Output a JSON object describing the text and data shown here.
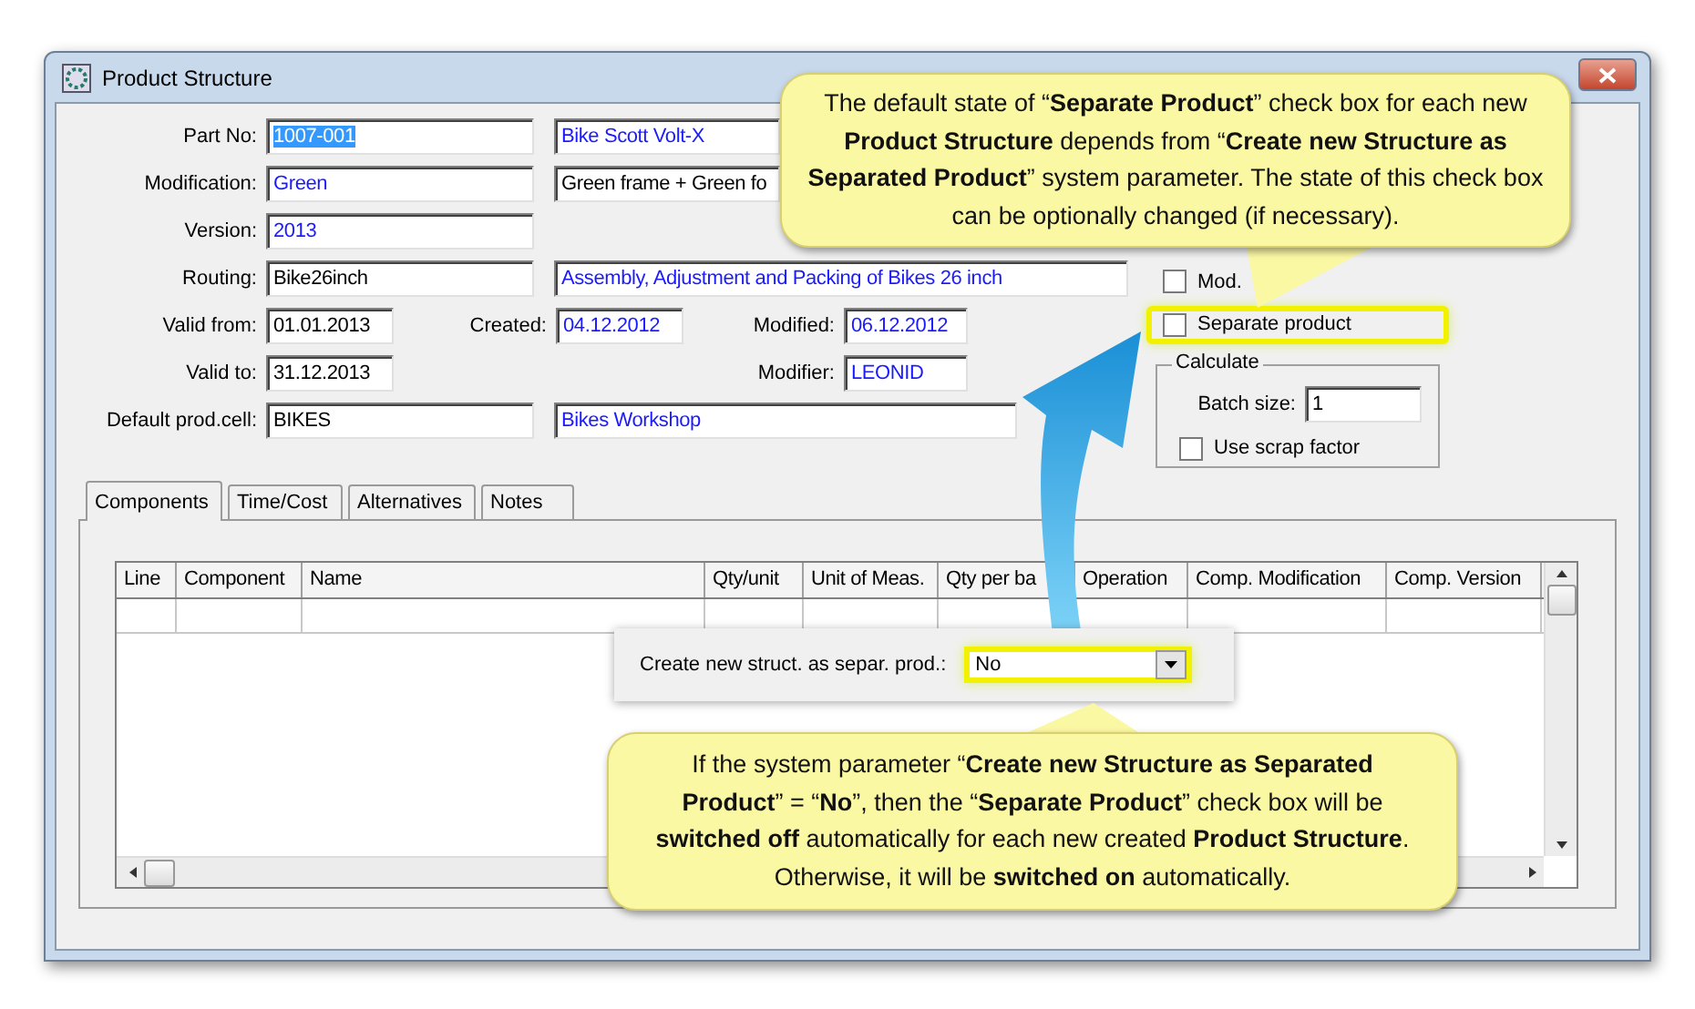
{
  "window": {
    "title": "Product Structure"
  },
  "form": {
    "part_no": {
      "label": "Part No:",
      "code": {
        "value": "1007-001",
        "text_selected": true
      },
      "name": {
        "value": "Bike Scott Volt-X",
        "readonly": true
      }
    },
    "modification": {
      "label": "Modification:",
      "code": {
        "value": "Green",
        "readonly": true
      },
      "name": {
        "value": "Green frame + Green fo",
        "readonly": false
      }
    },
    "version": {
      "label": "Version:",
      "code": {
        "value": "2013",
        "readonly": true
      }
    },
    "routing": {
      "label": "Routing:",
      "code": {
        "value": "Bike26inch",
        "readonly": false
      },
      "name": {
        "value": "Assembly, Adjustment and Packing of Bikes 26 inch",
        "readonly": true
      }
    },
    "valid_from": {
      "label": "Valid from:",
      "value": "01.01.2013",
      "readonly": false
    },
    "created": {
      "label": "Created:",
      "value": "04.12.2012",
      "readonly": true
    },
    "modified": {
      "label": "Modified:",
      "value": "06.12.2012",
      "readonly": true
    },
    "valid_to": {
      "label": "Valid to:",
      "value": "31.12.2013",
      "readonly": false
    },
    "modifier": {
      "label": "Modifier:",
      "value": "LEONID",
      "readonly": true
    },
    "default_prod_cell": {
      "label": "Default prod.cell:",
      "code": {
        "value": "BIKES",
        "readonly": false
      },
      "name": {
        "value": "Bikes Workshop",
        "readonly": true
      }
    }
  },
  "options": {
    "mod_p": {
      "label": "Mod.",
      "checked": false
    },
    "separate_product": {
      "label": "Separate product",
      "checked": false,
      "highlighted": true
    },
    "calculate": {
      "title": "Calculate",
      "batch_size": {
        "label": "Batch size:",
        "value": "1"
      },
      "use_scrap_factor": {
        "label": "Use scrap factor",
        "checked": false
      }
    }
  },
  "tabs": [
    {
      "label": "Components",
      "selected": true
    },
    {
      "label": "Time/Cost",
      "selected": false
    },
    {
      "label": "Alternatives",
      "selected": false
    },
    {
      "label": "Notes",
      "selected": false
    }
  ],
  "table": {
    "columns": [
      "Line",
      "Component",
      "Name",
      "Qty/unit",
      "Unit of Meas.",
      "Qty per ba",
      "Operation",
      "Comp. Modification",
      "Comp. Version"
    ]
  },
  "parameter_popup": {
    "label": "Create new struct. as separ. prod.:",
    "value": "No",
    "highlighted": true
  },
  "callouts": [
    {
      "text": "The default state of “**Separate Product**”  check box for each new **Product Structure** depends from “**Create new Structure as Separated Product**” system parameter.  The state of this check box can be optionally changed (if necessary)."
    },
    {
      "text": "If the system parameter  “**Create new Structure as Separated Product**” = “**No**”, then the “**Separate Product**” check box will be **switched off** automatically for each new created **Product Structure**. Otherwise, it will be **switched on** automatically."
    }
  ]
}
